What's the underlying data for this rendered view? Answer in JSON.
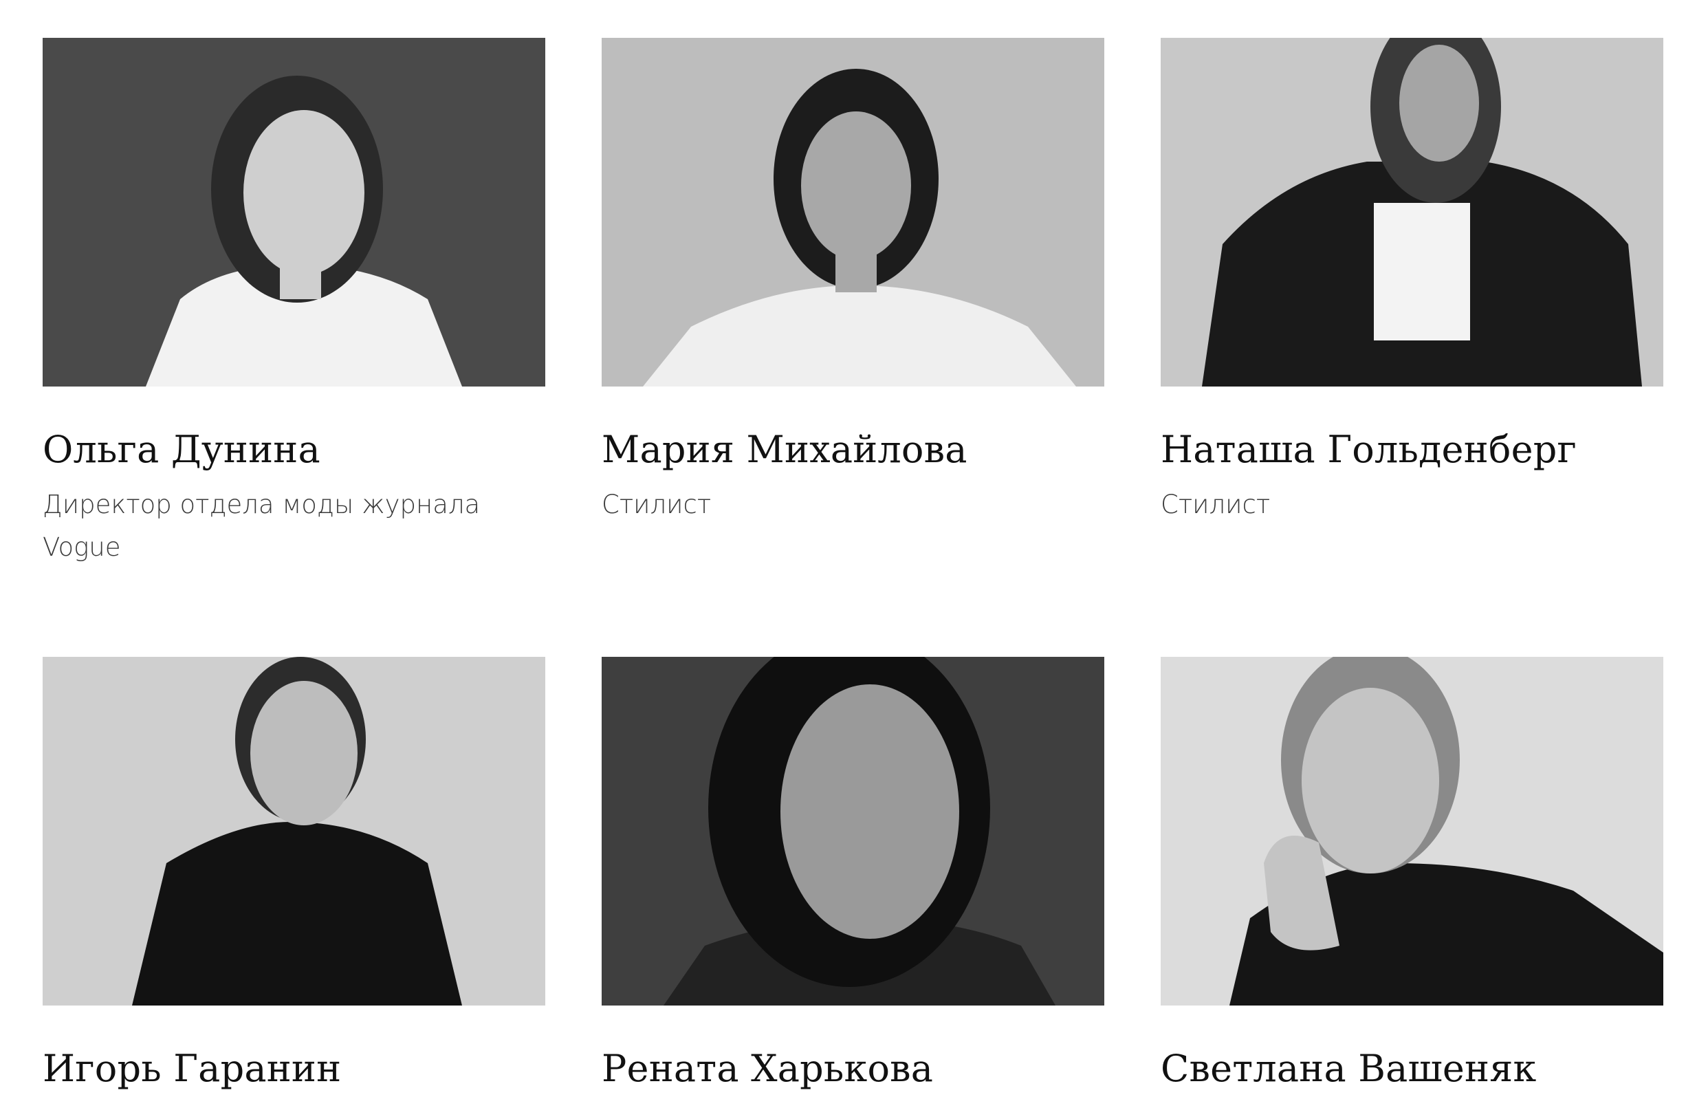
{
  "people": [
    {
      "name": "Ольга Дунина",
      "role": "Директор отдела моды журнала Vogue",
      "bg": "#4a4a4a",
      "shirt": "#f2f2f2",
      "hair": "#2a2a2a",
      "skin": "#cfcfcf"
    },
    {
      "name": "Мария Михайлова",
      "role": "Стилист",
      "bg": "#bdbdbd",
      "shirt": "#efefef",
      "hair": "#1c1c1c",
      "skin": "#a8a8a8"
    },
    {
      "name": "Наташа Гольденберг",
      "role": "Стилист",
      "bg": "#c8c8c8",
      "shirt": "#1a1a1a",
      "hair": "#3a3a3a",
      "skin": "#a5a5a5"
    },
    {
      "name": "Игорь Гаранин",
      "role": "",
      "bg": "#cfcfcf",
      "shirt": "#121212",
      "hair": "#2c2c2c",
      "skin": "#bdbdbd"
    },
    {
      "name": "Рената Харькова",
      "role": "",
      "bg": "#3f3f3f",
      "shirt": "#222222",
      "hair": "#0f0f0f",
      "skin": "#9a9a9a"
    },
    {
      "name": "Светлана Вашеняк",
      "role": "",
      "bg": "#dcdcdc",
      "shirt": "#151515",
      "hair": "#8a8a8a",
      "skin": "#c4c4c4"
    }
  ]
}
